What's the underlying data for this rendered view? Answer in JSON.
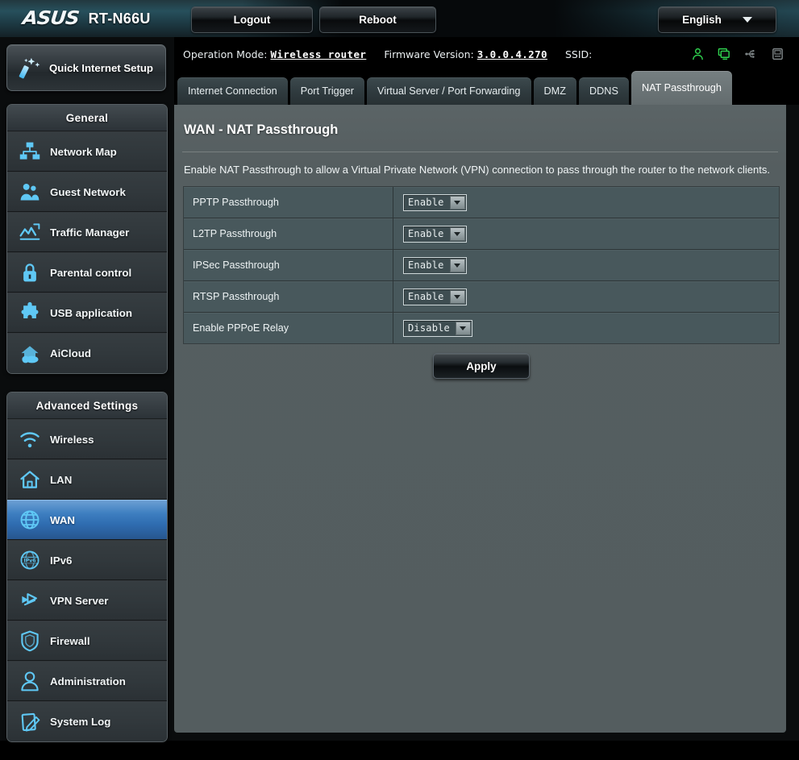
{
  "topbar": {
    "brand": "ASUS",
    "model": "RT-N66U",
    "logout_label": "Logout",
    "reboot_label": "Reboot",
    "language": "English"
  },
  "infostrip": {
    "operation_mode_label": "Operation Mode:",
    "operation_mode_value": "Wireless router",
    "firmware_label": "Firmware Version:",
    "firmware_value": "3.0.0.4.270",
    "ssid_label": "SSID:",
    "ssid_value": "",
    "status_icons": [
      {
        "name": "user-icon",
        "color": "#2fd24f"
      },
      {
        "name": "clients-icon",
        "color": "#2fd24f"
      },
      {
        "name": "usb-icon",
        "color": "#7d8486"
      },
      {
        "name": "printer-icon",
        "color": "#7d8486"
      }
    ]
  },
  "tabs": [
    {
      "label": "Internet Connection",
      "active": false
    },
    {
      "label": "Port Trigger",
      "active": false
    },
    {
      "label": "Virtual Server / Port Forwarding",
      "active": false
    },
    {
      "label": "DMZ",
      "active": false
    },
    {
      "label": "DDNS",
      "active": false
    },
    {
      "label": "NAT Passthrough",
      "active": true
    }
  ],
  "sidebar": {
    "quick_setup_label": "Quick Internet Setup",
    "general_title": "General",
    "general_items": [
      {
        "label": "Network Map",
        "icon": "network-map-icon"
      },
      {
        "label": "Guest Network",
        "icon": "guest-network-icon"
      },
      {
        "label": "Traffic Manager",
        "icon": "traffic-manager-icon"
      },
      {
        "label": "Parental control",
        "icon": "lock-icon"
      },
      {
        "label": "USB application",
        "icon": "puzzle-icon"
      },
      {
        "label": "AiCloud",
        "icon": "cloud-house-icon"
      }
    ],
    "advanced_title": "Advanced Settings",
    "advanced_items": [
      {
        "label": "Wireless",
        "icon": "wifi-icon",
        "selected": false
      },
      {
        "label": "LAN",
        "icon": "home-icon",
        "selected": false
      },
      {
        "label": "WAN",
        "icon": "globe-icon",
        "selected": true
      },
      {
        "label": "IPv6",
        "icon": "ipv6-icon",
        "selected": false
      },
      {
        "label": "VPN Server",
        "icon": "vpn-icon",
        "selected": false
      },
      {
        "label": "Firewall",
        "icon": "shield-icon",
        "selected": false
      },
      {
        "label": "Administration",
        "icon": "admin-user-icon",
        "selected": false
      },
      {
        "label": "System Log",
        "icon": "system-log-icon",
        "selected": false
      }
    ],
    "accent_color": "#3d7ec0"
  },
  "main": {
    "title": "WAN - NAT Passthrough",
    "description": "Enable NAT Passthrough to allow a Virtual Private Network (VPN) connection to pass through the router to the network clients.",
    "rows": [
      {
        "label": "PPTP Passthrough",
        "value": "Enable"
      },
      {
        "label": "L2TP Passthrough",
        "value": "Enable"
      },
      {
        "label": "IPSec Passthrough",
        "value": "Enable"
      },
      {
        "label": "RTSP Passthrough",
        "value": "Enable"
      },
      {
        "label": "Enable PPPoE Relay",
        "value": "Disable"
      }
    ],
    "options": [
      "Enable",
      "Disable"
    ],
    "apply_label": "Apply"
  }
}
